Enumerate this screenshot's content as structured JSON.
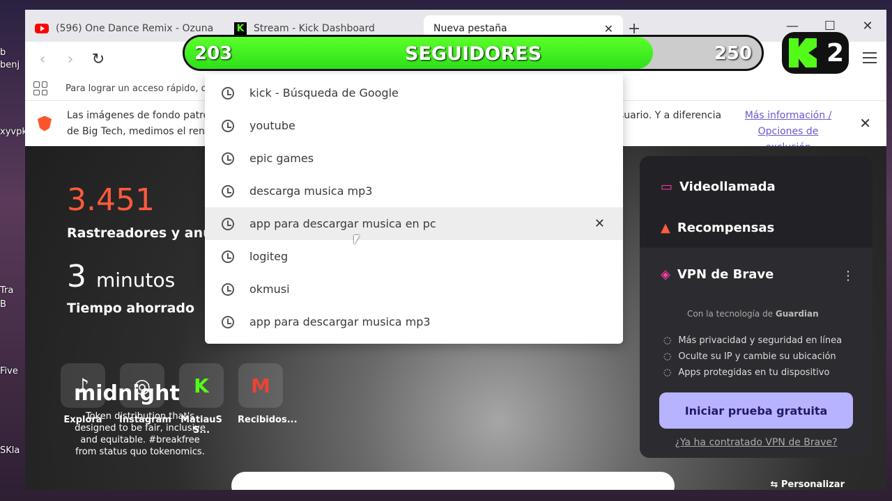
{
  "desktop": {
    "labels": [
      "b",
      "benj",
      "xyvpk",
      "Tra",
      "B",
      "Five",
      "SKla"
    ]
  },
  "tabs": [
    {
      "title": "(596) One Dance Remix - Ozuna Ft Ñ",
      "icon": "youtube-icon"
    },
    {
      "title": "Stream - Kick Dashboard",
      "icon": "kick-icon"
    },
    {
      "title": "Nueva pestaña",
      "icon": "none"
    }
  ],
  "bookmarks": {
    "hint": "Para lograr un acceso rápido, c"
  },
  "notice": {
    "text": "Las imágenes de fondo patro de Big Tech, medimos el rend",
    "text2": "suario. Y a diferencia",
    "link": "Más información / Opciones de exclusión"
  },
  "suggestions": [
    "kick - Búsqueda de Google",
    "youtube",
    "epic games",
    "descarga musica mp3",
    "app para descargar musica en pc",
    "logiteg",
    "okmusi",
    "app para descargar musica mp3"
  ],
  "stats": {
    "trackers_value": "3.451",
    "trackers_label": "Rastreadores y anun",
    "time_value": "3",
    "time_unit": "minutos",
    "time_label": "Tiempo ahorrado"
  },
  "shortcuts": [
    {
      "label": "Explora",
      "icon": "tiktok-icon"
    },
    {
      "label": "Instagram",
      "icon": "instagram-icon"
    },
    {
      "label": "MatiauS S...",
      "icon": "kick-icon"
    },
    {
      "label": "Recibidos...",
      "icon": "gmail-icon"
    }
  ],
  "sponsor": {
    "name": "midnight",
    "desc": "Token distribution that's designed to be fair, inclusive and equitable. #breakfree from status quo tokenomics."
  },
  "brave_panel": {
    "videollamada": "Videollamada",
    "recompensas": "Recompensas",
    "vpn_title": "VPN de Brave",
    "powered_by": "Con la tecnología de",
    "guardian": "Guardian",
    "bullets": [
      "Más privacidad y seguridad en línea",
      "Oculte su IP y cambie su ubicación",
      "Apps protegidas en tu dispositivo"
    ],
    "trial_button": "Iniciar prueba gratuita",
    "subscribed_link": "¿Ya ha contratado VPN de Brave?",
    "personalize": "Personalizar"
  },
  "overlay": {
    "current": "203",
    "label": "SEGUIDORES",
    "goal": "250",
    "progress_fraction": 0.812,
    "badge_number": "2",
    "accent": "#53fc18"
  }
}
